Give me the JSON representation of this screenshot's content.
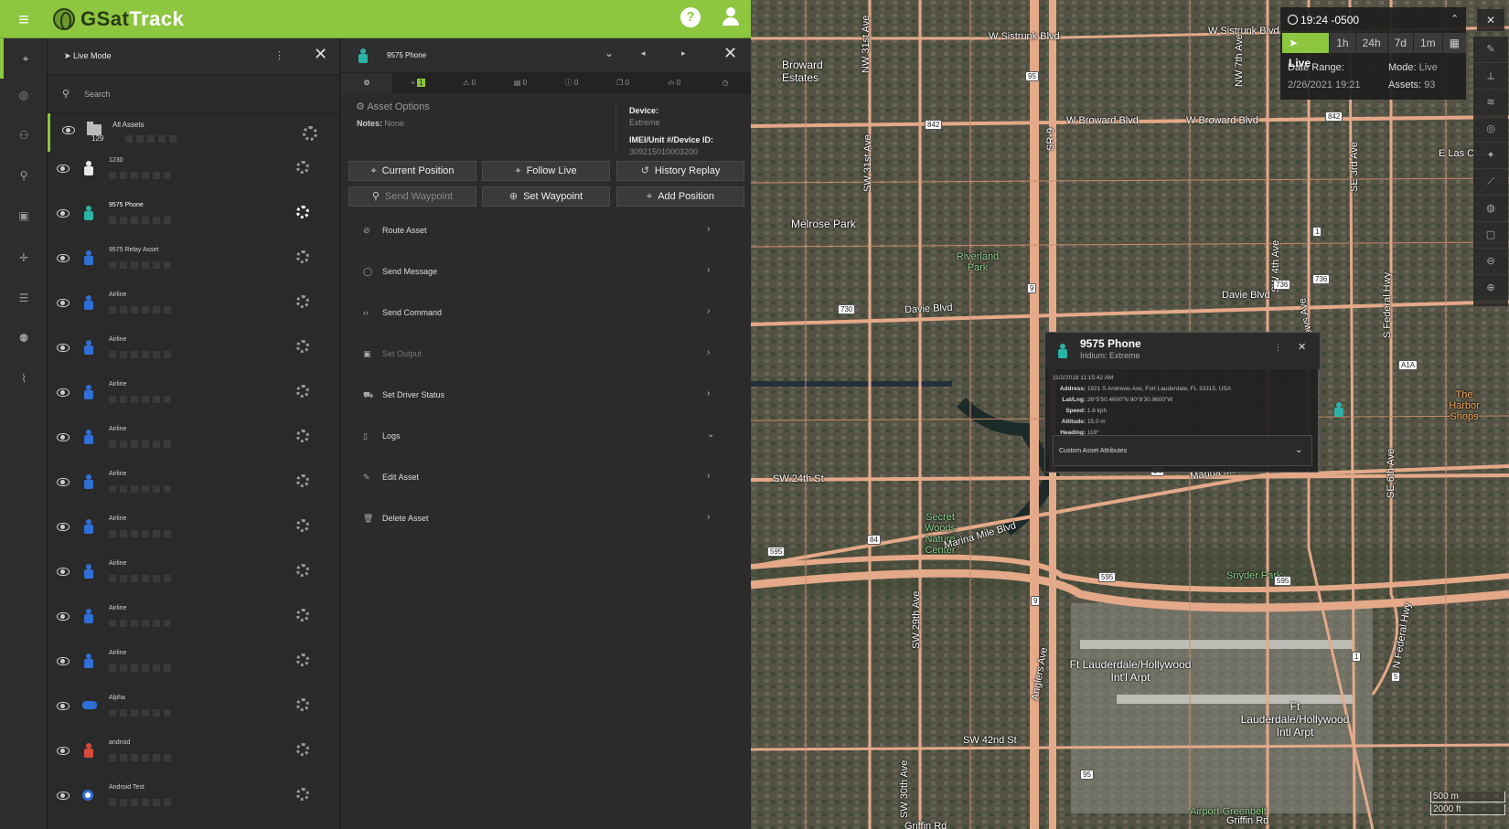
{
  "app": {
    "brand_g": "GSat",
    "brand_rest": "Track"
  },
  "icons": {
    "menu": "hamburger-icon",
    "help": "help-icon",
    "user": "user-icon",
    "rail": [
      "map-pin-icon",
      "compass-icon",
      "network-icon",
      "user-route-icon",
      "box-icon",
      "plus-icon",
      "list-icon",
      "users-icon",
      "chart-icon"
    ]
  },
  "colors": {
    "accent": "#8dc63f",
    "asset_teal": "#2ab3a6",
    "asset_blue": "#2f6fd6",
    "asset_red": "#d84a3c"
  },
  "asset_panel": {
    "mode_label": "Live Mode",
    "search_placeholder": "Search",
    "all_assets": {
      "label": "All Assets",
      "count": "129"
    },
    "assets": [
      {
        "name": "1230",
        "icon": "person",
        "color": "#e8e8e8"
      },
      {
        "name": "9575 Phone",
        "icon": "person",
        "color": "#2ab3a6",
        "selected": true
      },
      {
        "name": "9575 Relay Asset",
        "icon": "person",
        "color": "#2f6fd6"
      },
      {
        "name": "Airline",
        "icon": "person",
        "color": "#2f6fd6"
      },
      {
        "name": "Airline",
        "icon": "person",
        "color": "#2f6fd6"
      },
      {
        "name": "Airline",
        "icon": "person",
        "color": "#2f6fd6"
      },
      {
        "name": "Airline",
        "icon": "person",
        "color": "#2f6fd6"
      },
      {
        "name": "Airline",
        "icon": "person",
        "color": "#2f6fd6"
      },
      {
        "name": "Airline",
        "icon": "person",
        "color": "#2f6fd6"
      },
      {
        "name": "Airline",
        "icon": "person",
        "color": "#2f6fd6"
      },
      {
        "name": "Airline",
        "icon": "person",
        "color": "#2f6fd6"
      },
      {
        "name": "Airline",
        "icon": "person",
        "color": "#2f6fd6"
      },
      {
        "name": "Alpha",
        "icon": "car",
        "color": "#2f6fd6"
      },
      {
        "name": "android",
        "icon": "person",
        "color": "#d84a3c"
      },
      {
        "name": "Android Test",
        "icon": "circle",
        "color": "#2f6fd6"
      }
    ]
  },
  "detail": {
    "title": "9575 Phone",
    "tabs": [
      {
        "icon": "options-icon",
        "count": ""
      },
      {
        "icon": "pin-icon",
        "count": "1"
      },
      {
        "icon": "alert-icon",
        "count": "0"
      },
      {
        "icon": "doc-icon",
        "count": "0"
      },
      {
        "icon": "info-icon",
        "count": "0"
      },
      {
        "icon": "chat-icon",
        "count": "0"
      },
      {
        "icon": "code-icon",
        "count": "0"
      },
      {
        "icon": "clock-icon",
        "count": ""
      }
    ],
    "options_header": "Asset Options",
    "notes_label": "Notes:",
    "notes_value": "None",
    "device_label": "Device:",
    "device_value": "Extreme",
    "imei_label": "IMEI/Unit #/Device ID:",
    "imei_value": "309215010003200",
    "buttons": [
      "Current Position",
      "Follow Live",
      "History Replay",
      "Send Waypoint",
      "Set Waypoint",
      "Add Position"
    ],
    "menu": [
      {
        "label": "Route Asset",
        "icon": "route-icon",
        "chev": "›"
      },
      {
        "label": "Send Message",
        "icon": "message-icon",
        "chev": "›"
      },
      {
        "label": "Send Command",
        "icon": "code-icon",
        "chev": "›"
      },
      {
        "label": "Set Output",
        "icon": "output-icon",
        "chev": "›",
        "disabled": true
      },
      {
        "label": "Set Driver Status",
        "icon": "truck-icon",
        "chev": "›"
      },
      {
        "label": "Logs",
        "icon": "clipboard-icon",
        "chev": "⌄"
      },
      {
        "label": "Edit Asset",
        "icon": "edit-icon",
        "chev": "›"
      },
      {
        "label": "Delete Asset",
        "icon": "trash-icon",
        "chev": "›"
      }
    ]
  },
  "time_panel": {
    "time": "19:24 -0500",
    "ranges": [
      "Live",
      "1h",
      "24h",
      "7d",
      "1m"
    ],
    "date_range_label": "Date Range:",
    "date_range_value": "2/26/2021 19:21",
    "mode_label": "Mode:",
    "mode_value": "Live",
    "assets_label": "Assets:",
    "assets_value": "93"
  },
  "popup": {
    "title": "9575 Phone",
    "subtitle": "Iridium: Extreme",
    "timestamp": "11/2/2018 11:15:42 AM",
    "fields": [
      {
        "label": "Address:",
        "value": "1921 S Andrews Ave, Fort Lauderdale, FL 33315, USA"
      },
      {
        "label": "Lat/Lng:",
        "value": "26°5'50.4600\"N 80°8'30.9600\"W"
      },
      {
        "label": "Speed:",
        "value": "1.6 kph"
      },
      {
        "label": "Altitude:",
        "value": "15.0 m"
      },
      {
        "label": "Heading:",
        "value": "118°"
      }
    ],
    "custom_attrs": "Custom Asset Attributes"
  },
  "map_labels": [
    "W Sistrunk Blvd",
    "W Sistrunk Blvd",
    "Broward Estates",
    "NW 31st Ave",
    "NW 7th Ave",
    "W Broward Blvd",
    "W Broward Blvd",
    "E Las Olas",
    "SW 31st Ave",
    "Melrose Park",
    "Riverland Park",
    "SR-9",
    "SW 4th Ave",
    "S Andrews Ave",
    "SE 3rd Ave",
    "S Federal Hwy",
    "Davie Blvd",
    "Davie Blvd",
    "SW 24th St",
    "Secret Woods Nature Center",
    "Marina Mile Blvd",
    "Marina Mile Blvd",
    "SE 6th Ave",
    "The Harbor Shops",
    "Snyder Park",
    "SW 29th Ave",
    "Ft Lauderdale/Hollywood Int'l Arpt",
    "Ft Lauderdale/Hollywood Intl Arpt",
    "Anglers Ave",
    "N Federal Hwy",
    "SW 42nd St",
    "SW 30th Ave",
    "Airport Greenbelt",
    "Griffin Rd",
    "Griffin Rd"
  ],
  "route_shields": [
    "95",
    "842",
    "842",
    "9",
    "736",
    "730",
    "1",
    "736",
    "84",
    "84",
    "595",
    "595",
    "595",
    "A1A",
    "9",
    "1",
    "5",
    "95"
  ],
  "scale": {
    "metric": "500 m",
    "imperial": "2000 ft"
  }
}
